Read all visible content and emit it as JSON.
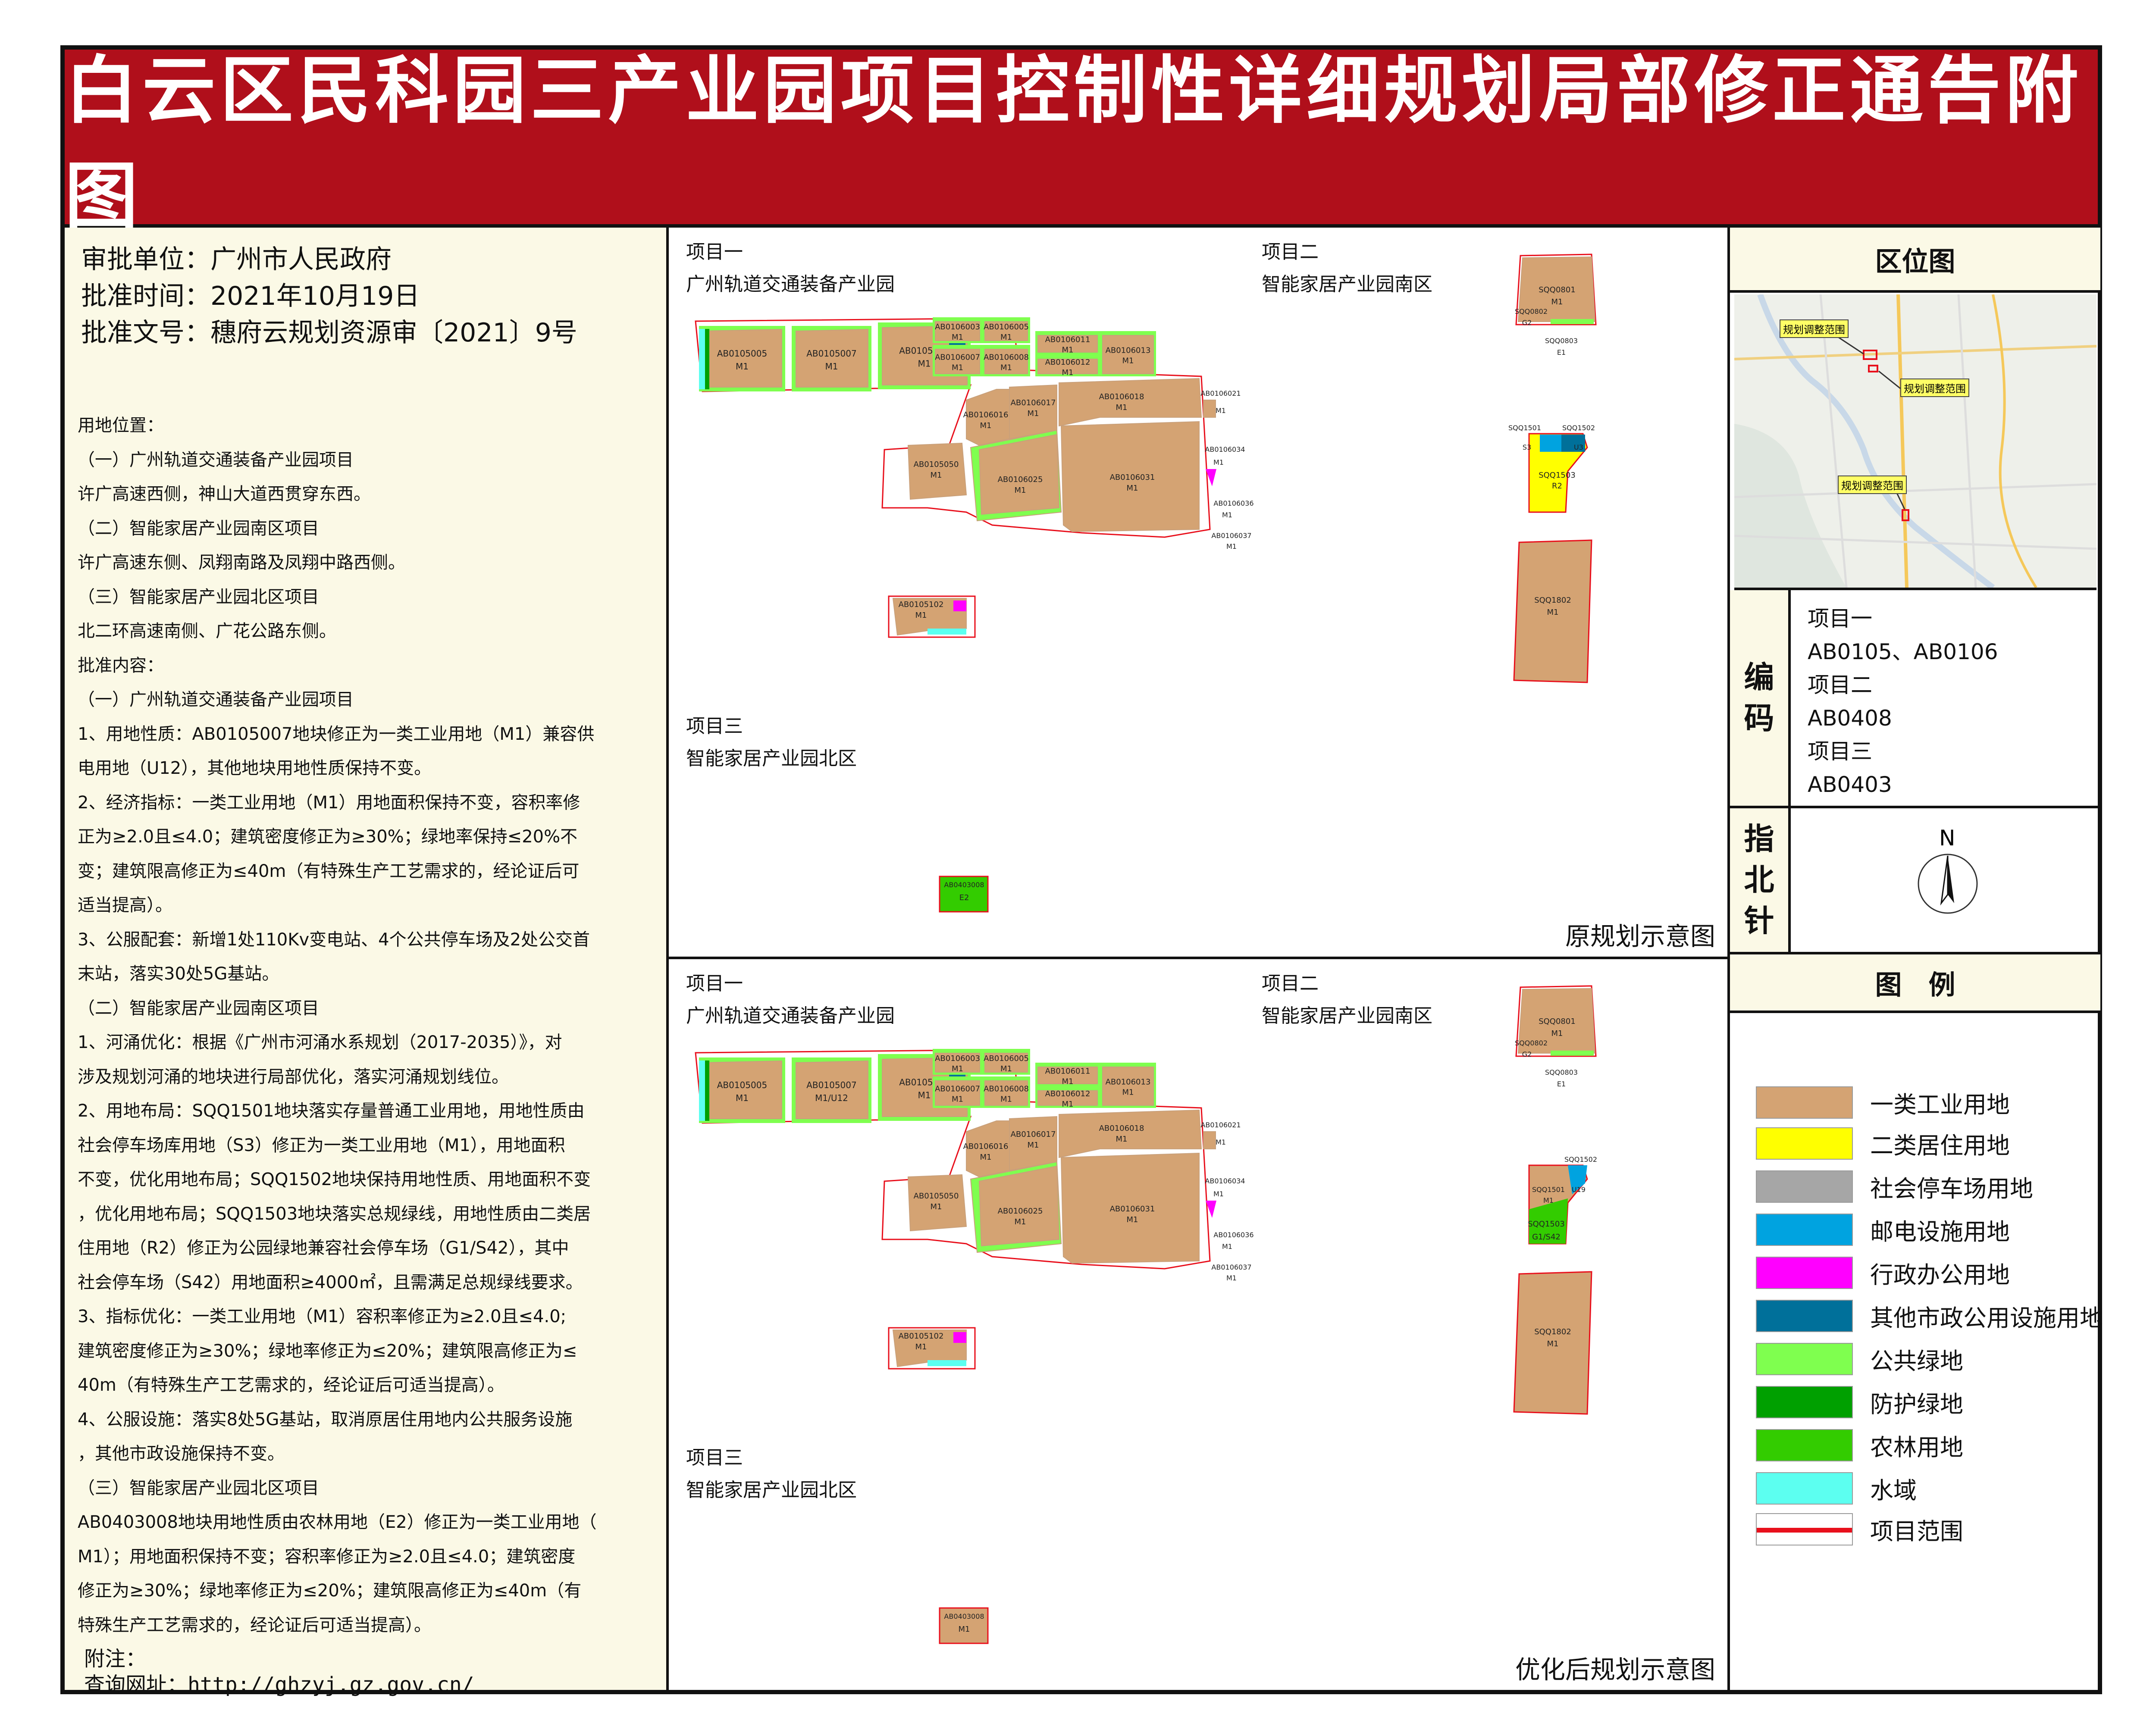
{
  "title": "白云区民科园三产业园项目控制性详细规划局部修正通告附图",
  "left": {
    "head": [
      "审批单位：广州市人民政府",
      "批准时间：2021年10月19日",
      "批准文号：穗府云规划资源审〔2021〕9号"
    ],
    "body": [
      "用地位置：",
      "（一）广州轨道交通装备产业园项目",
      "许广高速西侧，神山大道西贯穿东西。",
      "（二）智能家居产业园南区项目",
      "许广高速东侧、凤翔南路及凤翔中路西侧。",
      "（三）智能家居产业园北区项目",
      "北二环高速南侧、广花公路东侧。",
      "批准内容：",
      "（一）广州轨道交通装备产业园项目",
      "1、用地性质：AB0105007地块修正为一类工业用地（M1）兼容供",
      "电用地（U12），其他地块用地性质保持不变。",
      "2、经济指标：一类工业用地（M1）用地面积保持不变，容积率修",
      "正为≥2.0且≤4.0；建筑密度修正为≥30%；绿地率保持≤20%不",
      "变；建筑限高修正为≤40m（有特殊生产工艺需求的，经论证后可",
      "适当提高）。",
      "3、公服配套：新增1处110Kv变电站、4个公共停车场及2处公交首",
      "末站，落实30处5G基站。",
      "（二）智能家居产业园南区项目",
      "1、河涌优化：根据《广州市河涌水系规划（2017-2035）》，对",
      "涉及规划河涌的地块进行局部优化，落实河涌规划线位。",
      "2、用地布局：SQQ1501地块落实存量普通工业用地，用地性质由",
      "社会停车场库用地（S3）修正为一类工业用地（M1），用地面积",
      "不变，优化用地布局；SQQ1502地块保持用地性质、用地面积不变",
      "，优化用地布局；SQQ1503地块落实总规绿线，用地性质由二类居",
      "住用地（R2）修正为公园绿地兼容社会停车场（G1/S42），其中",
      "社会停车场（S42）用地面积≥4000㎡，且需满足总规绿线要求。",
      "3、指标优化：一类工业用地（M1）容积率修正为≥2.0且≤4.0;",
      "建筑密度修正为≥30%；绿地率修正为≤20%；建筑限高修正为≤",
      "40m（有特殊生产工艺需求的，经论证后可适当提高）。",
      "4、公服设施：落实8处5G基站，取消原居住用地内公共服务设施",
      "，其他市政设施保持不变。",
      "（三）智能家居产业园北区项目",
      "AB0403008地块用地性质由农林用地（E2）修正为一类工业用地（",
      "M1）；用地面积保持不变；容积率修正为≥2.0且≤4.0；建筑密度",
      "修正为≥30%；绿地率修正为≤20%；建筑限高修正为≤40m（有",
      "特殊生产工艺需求的，经论证后可适当提高）。"
    ],
    "note": "附注：",
    "url": "查询网址：http://ghzyj.gz.gov.cn/"
  },
  "map_top": {
    "p1_title": "项目一",
    "p1_name": "广州轨道交通装备产业园",
    "p2_title": "项目二",
    "p2_name": "智能家居产业园南区",
    "p3_title": "项目三",
    "p3_name": "智能家居产业园北区",
    "caption": "原规划示意图"
  },
  "map_bottom": {
    "p1_title": "项目一",
    "p1_name": "广州轨道交通装备产业园",
    "p2_title": "项目二",
    "p2_name": "智能家居产业园南区",
    "p3_title": "项目三",
    "p3_name": "智能家居产业园北区",
    "caption": "优化后规划示意图"
  },
  "parcels_top": {
    "a1": "AB0105005",
    "a1u": "M1",
    "a2": "AB0105007",
    "a2u": "M1",
    "a3": "AB0105010",
    "a3u": "M1",
    "b1": "AB0106003",
    "b1u": "M1",
    "b2": "AB0106005",
    "b2u": "M1",
    "b3": "AB0106007",
    "b3u": "M1",
    "b4": "AB0106008",
    "b4u": "M1",
    "b5": "AB0106011",
    "b5u": "M1",
    "b6": "AB0106012",
    "b6u": "M1",
    "b7": "AB0106013",
    "b7u": "M1",
    "c1": "AB0106016",
    "c1u": "M1",
    "c2": "AB0106017",
    "c2u": "M1",
    "c3": "AB0106018",
    "c3u": "M1",
    "c4": "AB0106021",
    "c4u": "M1",
    "d1": "AB0105050",
    "d1u": "M1",
    "d2": "AB0106025",
    "d2u": "M1",
    "d3": "AB0106031",
    "d3u": "M1",
    "d4": "AB0106034",
    "d4u": "M1",
    "d5": "AB0106036",
    "d5u": "M1",
    "d6": "AB0106037",
    "d6u": "M1",
    "e1": "AB0105102",
    "e1u": "M1",
    "s1": "SQQ0801",
    "s1u": "M1",
    "s2": "SQQ0802",
    "s2u": "G2",
    "s3": "SQQ0803",
    "s3u": "E1",
    "s4": "SQQ1501",
    "s4u": "S3",
    "s5": "SQQ1502",
    "s5u": "U3",
    "s6": "SQQ1503",
    "s6u": "R2",
    "s7": "SQQ1802",
    "s7u": "M1",
    "n1": "AB0403008",
    "n1u": "E2"
  },
  "parcels_bottom": {
    "a1": "AB0105005",
    "a1u": "M1",
    "a2": "AB0105007",
    "a2u": "M1/U12",
    "a3": "AB0105010",
    "a3u": "M1",
    "b1": "AB0106003",
    "b1u": "M1",
    "b2": "AB0106005",
    "b2u": "M1",
    "b3": "AB0106007",
    "b3u": "M1",
    "b4": "AB0106008",
    "b4u": "M1",
    "b5": "AB0106011",
    "b5u": "M1",
    "b6": "AB0106012",
    "b6u": "M1",
    "b7": "AB0106013",
    "b7u": "M1",
    "c1": "AB0106016",
    "c1u": "M1",
    "c2": "AB0106017",
    "c2u": "M1",
    "c3": "AB0106018",
    "c3u": "M1",
    "c4": "AB0106021",
    "c4u": "M1",
    "d1": "AB0105050",
    "d1u": "M1",
    "d2": "AB0106025",
    "d2u": "M1",
    "d3": "AB0106031",
    "d3u": "M1",
    "d4": "AB0106034",
    "d4u": "M1",
    "d5": "AB0106036",
    "d5u": "M1",
    "d6": "AB0106037",
    "d6u": "M1",
    "e1": "AB0105102",
    "e1u": "M1",
    "s1": "SQQ0801",
    "s1u": "M1",
    "s2": "SQQ0802",
    "s2u": "G2",
    "s3": "SQQ0803",
    "s3u": "E1",
    "s4": "SQQ1501",
    "s4u": "M1",
    "s5": "SQQ1502",
    "s5u": "U19",
    "s6": "SQQ1503",
    "s6u": "G1/S42",
    "s7": "SQQ1802",
    "s7u": "M1",
    "n1": "AB0403008",
    "n1u": "M1"
  },
  "right": {
    "loc_title": "区位图",
    "loc_labels": [
      "规划调整范围",
      "规划调整范围",
      "规划调整范围"
    ],
    "code_label": [
      "编",
      "码"
    ],
    "code_lines": [
      "项目一",
      "AB0105、AB0106",
      "项目二",
      "AB0408",
      "项目三",
      "AB0403"
    ],
    "north_label": [
      "指",
      "北",
      "针"
    ],
    "north_letter": "N",
    "legend_title": "图　例",
    "legend": [
      {
        "label": "一类工业用地",
        "color": "#d4a373"
      },
      {
        "label": "二类居住用地",
        "color": "#ffff00"
      },
      {
        "label": "社会停车场用地",
        "color": "#a6a6a6"
      },
      {
        "label": "邮电设施用地",
        "color": "#00a3e0"
      },
      {
        "label": "行政办公用地",
        "color": "#ff00ff"
      },
      {
        "label": "其他市政公用设施用地",
        "color": "#00709a"
      },
      {
        "label": "公共绿地",
        "color": "#7fff4f"
      },
      {
        "label": "防护绿地",
        "color": "#00a000"
      },
      {
        "label": "农林用地",
        "color": "#33cc00"
      },
      {
        "label": "水域",
        "color": "#5cfff0"
      },
      {
        "label": "项目范围",
        "color": "#e8101c"
      }
    ]
  }
}
